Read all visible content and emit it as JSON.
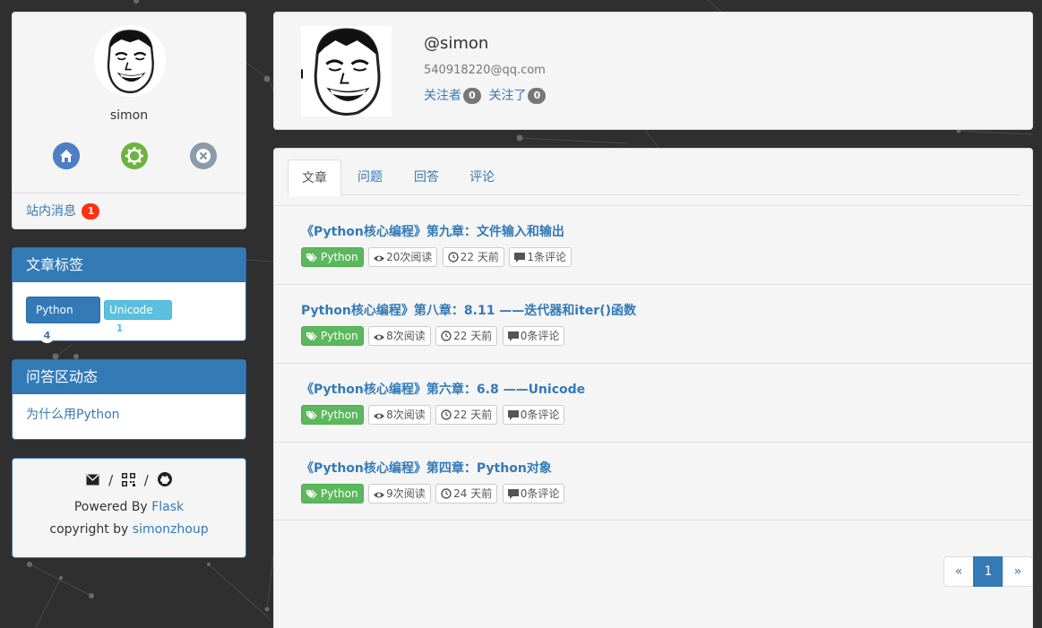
{
  "sidebar": {
    "profile": {
      "name": "simon",
      "icons": [
        "home-icon",
        "settings-icon",
        "logout-icon"
      ],
      "messages_label": "站内消息",
      "messages_count": "1"
    },
    "tags_panel": {
      "title": "文章标签",
      "tags": [
        {
          "label": "Python",
          "count": "4"
        },
        {
          "label": "Unicode",
          "count": "1"
        }
      ]
    },
    "qa_panel": {
      "title": "问答区动态",
      "items": [
        "为什么用Python"
      ]
    },
    "footer": {
      "separator": "/",
      "powered_prefix": "Powered By",
      "powered_link": "Flask",
      "copyright_prefix": "copyright by",
      "copyright_link": "simonzhoup"
    }
  },
  "user": {
    "username": "@simon",
    "email": "540918220@qq.com",
    "followers_label": "关注者",
    "followers_count": "0",
    "following_label": "关注了",
    "following_count": "0"
  },
  "tabs": [
    "文章",
    "问题",
    "回答",
    "评论"
  ],
  "articles": [
    {
      "title": "《Python核心编程》第九章：文件输入和输出",
      "tag": "Python",
      "views": "20次阅读",
      "time": "22 天前",
      "comments": "1条评论"
    },
    {
      "title": "Python核心编程》第八章：8.11 ——迭代器和iter()函数",
      "tag": "Python",
      "views": "8次阅读",
      "time": "22 天前",
      "comments": "0条评论"
    },
    {
      "title": "《Python核心编程》第六章：6.8 ——Unicode",
      "tag": "Python",
      "views": "8次阅读",
      "time": "22 天前",
      "comments": "0条评论"
    },
    {
      "title": "《Python核心编程》第四章：Python对象",
      "tag": "Python",
      "views": "9次阅读",
      "time": "24 天前",
      "comments": "0条评论"
    }
  ],
  "pagination": {
    "prev": "«",
    "current": "1",
    "next": "»"
  },
  "colors": {
    "primary": "#337ab7",
    "success": "#5cb85c",
    "info": "#5bc0de",
    "danger": "#ff2f10"
  }
}
